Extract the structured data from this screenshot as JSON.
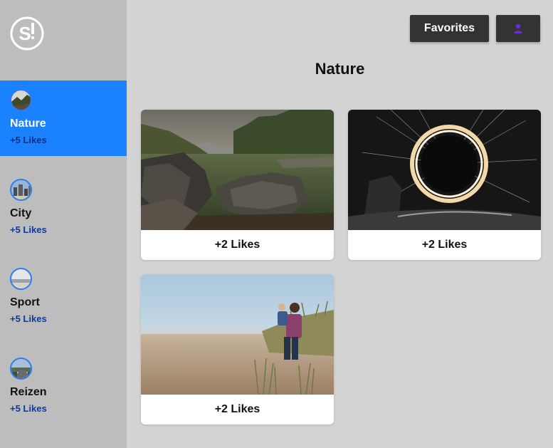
{
  "sidebar": {
    "logo_icon": "s-exclamation-logo",
    "categories": [
      {
        "name": "Nature",
        "likes": "+5 Likes",
        "active": true
      },
      {
        "name": "City",
        "likes": "+5 Likes",
        "active": false
      },
      {
        "name": "Sport",
        "likes": "+5 Likes",
        "active": false
      },
      {
        "name": "Reizen",
        "likes": "+5 Likes",
        "active": false
      }
    ]
  },
  "header": {
    "favorites_label": "Favorites",
    "user_icon": "user-icon",
    "user_icon_color": "#6a2ccf"
  },
  "main": {
    "title": "Nature",
    "cards": [
      {
        "image": "river-rocks-mountains-photo",
        "likes": "+2 Likes"
      },
      {
        "image": "steel-wool-light-circle-photo",
        "likes": "+2 Likes"
      },
      {
        "image": "beach-father-child-photo",
        "likes": "+2 Likes"
      }
    ]
  },
  "colors": {
    "accent": "#1a82ff",
    "sidebar": "#bdbdbd",
    "background": "#d3d3d3",
    "button": "#333333",
    "likes_text": "#0b3aa5"
  }
}
